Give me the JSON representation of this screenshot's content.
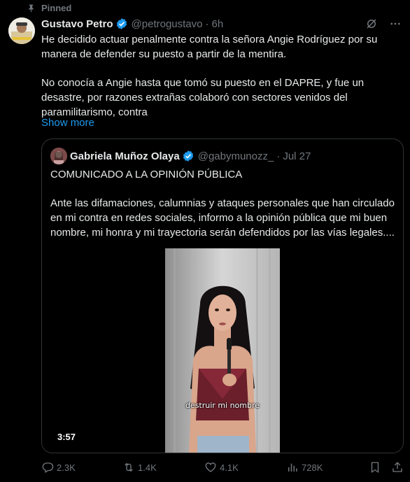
{
  "pinned": {
    "label": "Pinned"
  },
  "author": {
    "name": "Gustavo Petro",
    "handle": "@petrogustavo",
    "separator": "·",
    "time": "6h"
  },
  "tweet": {
    "paragraphs": [
      "He decidido actuar penalmente contra la señora Angie Rodríguez por su manera de defender su puesto a partir de la mentira.",
      "No conocía a Angie hasta que tomó su puesto en el DAPRE, y fue un desastre, por razones extrañas colaboró con sectores venidos del paramilitarismo, contra"
    ],
    "show_more": "Show more"
  },
  "quote": {
    "name": "Gabriela Muñoz Olaya",
    "handle": "@gabymunozz_",
    "separator": "·",
    "time": "Jul 27",
    "paragraphs": [
      "COMUNICADO A LA OPINIÓN PÚBLICA",
      "Ante las difamaciones, calumnias y ataques personales que han circulado en mi contra en redes sociales, informo a la opinión pública que mi buen nombre, mi honra y mi trayectoria serán defendidos por las vías legales...."
    ],
    "video": {
      "duration": "3:57",
      "caption": "destruir mi nombre"
    }
  },
  "actions": {
    "replies": "2.3K",
    "reposts": "1.4K",
    "likes": "4.1K",
    "views": "728K"
  },
  "icons": {
    "pin": "pin-icon",
    "verified": "verified-badge-icon",
    "grok": "grok-icon",
    "more": "more-icon",
    "reply": "reply-icon",
    "repost": "repost-icon",
    "like": "heart-icon",
    "views": "views-icon",
    "bookmark": "bookmark-icon",
    "share": "share-icon"
  },
  "colors": {
    "background": "#000000",
    "text": "#e7e9ea",
    "muted": "#71767b",
    "accent": "#1d9bf0",
    "border": "#2f3336"
  }
}
